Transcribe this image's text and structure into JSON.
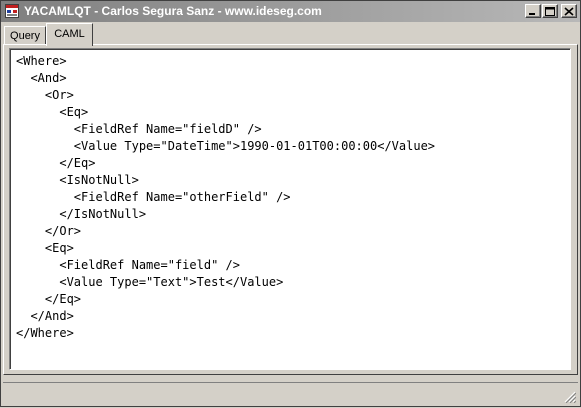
{
  "window": {
    "title": "YACAMLQT - Carlos Segura Sanz - www.ideseg.com"
  },
  "tabs": [
    {
      "label": "Query",
      "active": false
    },
    {
      "label": "CAML",
      "active": true
    }
  ],
  "editor": {
    "lines": [
      "<Where>",
      "  <And>",
      "    <Or>",
      "      <Eq>",
      "        <FieldRef Name=\"fieldD\" />",
      "        <Value Type=\"DateTime\">1990-01-01T00:00:00</Value>",
      "      </Eq>",
      "      <IsNotNull>",
      "        <FieldRef Name=\"otherField\" />",
      "      </IsNotNull>",
      "    </Or>",
      "    <Eq>",
      "      <FieldRef Name=\"field\" />",
      "      <Value Type=\"Text\">Test</Value>",
      "    </Eq>",
      "  </And>",
      "</Where>"
    ]
  },
  "icons": {
    "app": "app-icon",
    "minimize": "minimize-icon",
    "maximize": "maximize-icon",
    "close": "close-icon",
    "grip": "size-grip-icon"
  }
}
